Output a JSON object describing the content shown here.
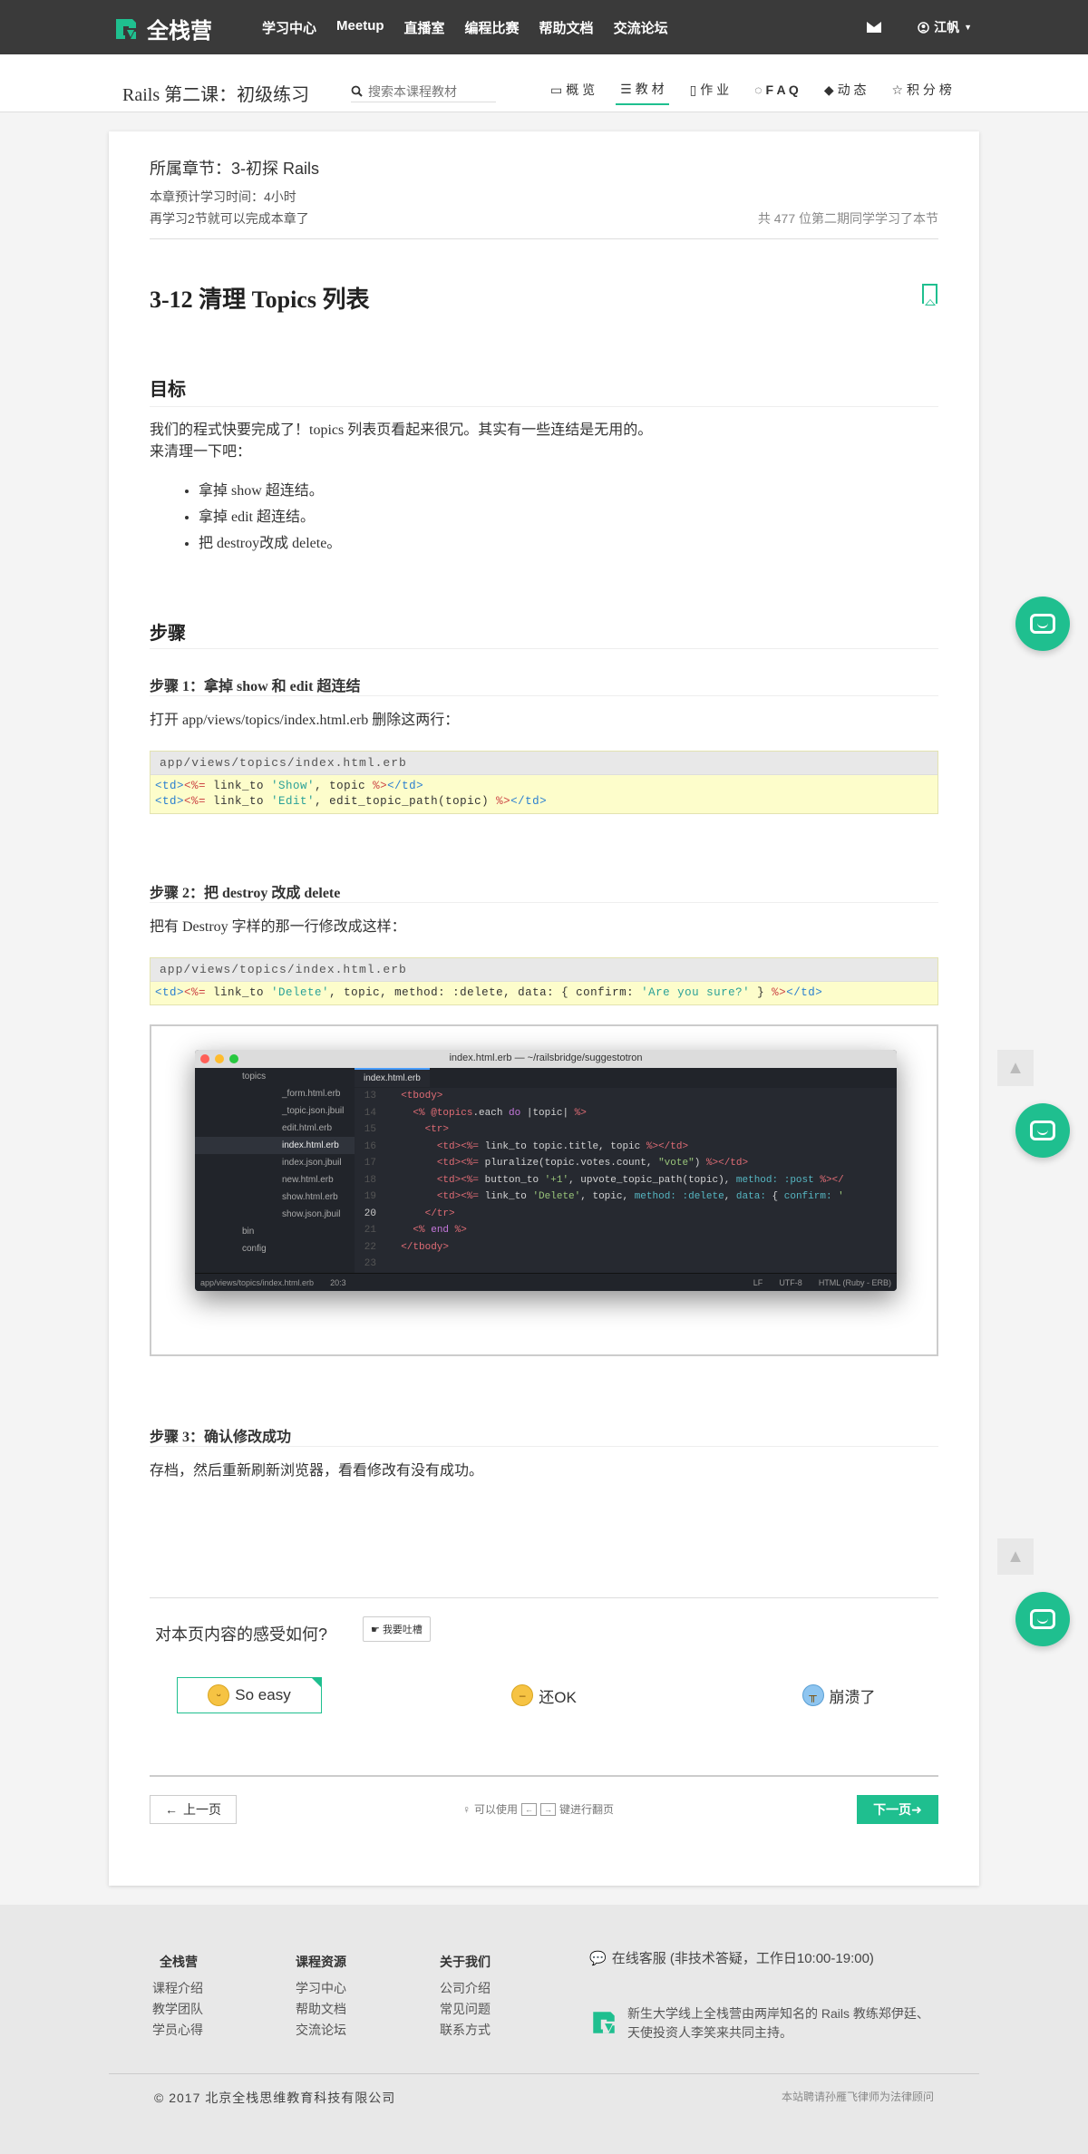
{
  "topnav": {
    "brand": "全栈营",
    "links": [
      "学习中心",
      "Meetup",
      "直播室",
      "编程比赛",
      "帮助文档",
      "交流论坛"
    ],
    "user": "江帆"
  },
  "subnav": {
    "course_title": "Rails 第二课：初级练习",
    "search_placeholder": "搜索本课程教材",
    "tabs": [
      {
        "label": "概 览",
        "icon": "monitor-icon"
      },
      {
        "label": "教 材",
        "icon": "list-icon"
      },
      {
        "label": "作 业",
        "icon": "file-icon"
      },
      {
        "label": "F A Q",
        "icon": "chat-icon"
      },
      {
        "label": "动 态",
        "icon": "tag-icon"
      },
      {
        "label": "积 分 榜",
        "icon": "star-icon"
      }
    ],
    "active_tab": 1
  },
  "card": {
    "chapter": "所属章节：3-初探 Rails",
    "study_time": "本章预计学习时间：4小时",
    "remaining": "再学习2节就可以完成本章了",
    "learners": "共 477 位第二期同学学习了本节",
    "lesson_title": "3-12 清理 Topics 列表",
    "goal_heading": "目标",
    "goal_text_1": "我们的程式快要完成了！topics 列表页看起来很冗。其实有一些连结是无用的。",
    "goal_text_2": "来清理一下吧：",
    "goal_bullets": [
      "拿掉 show 超连结。",
      "拿掉 edit 超连结。",
      "把 destroy改成 delete。"
    ],
    "steps_heading": "步骤",
    "step1_heading": "步骤 1：拿掉 show 和 edit 超连结",
    "step1_text": "打开 app/views/topics/index.html.erb 删除这两行：",
    "code1_file": "app/views/topics/index.html.erb",
    "step2_heading": "步骤 2：把 destroy 改成 delete",
    "step2_text": "把有 Destroy 字样的那一行修改成这样：",
    "code2_file": "app/views/topics/index.html.erb",
    "step3_heading": "步骤 3：确认修改成功",
    "step3_text": "存档，然后重新刷新浏览器，看看修改有没有成功。"
  },
  "editor": {
    "title": "index.html.erb — ~/railsbridge/suggestotron",
    "tab": "index.html.erb",
    "files": [
      "topics",
      "_form.html.erb",
      "_topic.json.jbuil",
      "edit.html.erb",
      "index.html.erb",
      "index.json.jbuil",
      "new.html.erb",
      "show.html.erb",
      "show.json.jbuil",
      "",
      "bin",
      "config"
    ],
    "line_numbers": [
      "13",
      "14",
      "15",
      "16",
      "17",
      "18",
      "19",
      "20",
      "21",
      "22",
      "23"
    ],
    "status_path": "app/views/topics/index.html.erb",
    "status_pos": "20:3",
    "status_lf": "LF",
    "status_enc": "UTF-8",
    "status_grammar": "HTML (Ruby - ERB)"
  },
  "feedback": {
    "question": "对本页内容的感受如何?",
    "complain_button": "我要吐槽",
    "options": [
      "So easy",
      "还OK",
      "崩溃了"
    ]
  },
  "pager": {
    "prev": "上一页",
    "hint_before": "可以使用",
    "hint_after": "键进行翻页",
    "next": "下一页"
  },
  "footer": {
    "col1": {
      "title": "全栈营",
      "items": [
        "课程介绍",
        "教学团队",
        "学员心得"
      ]
    },
    "col2": {
      "title": "课程资源",
      "items": [
        "学习中心",
        "帮助文档",
        "交流论坛"
      ]
    },
    "col3": {
      "title": "关于我们",
      "items": [
        "公司介绍",
        "常见问题",
        "联系方式"
      ]
    },
    "service": "在线客服 (非技术答疑，工作日10:00-19:00)",
    "description": "新生大学线上全栈营由两岸知名的 Rails 教练郑伊廷、天使投资人李笑来共同主持。",
    "copyright": "© 2017 北京全栈思维教育科技有限公司",
    "legal": "本站聘请孙雁飞律师为法律顾问"
  },
  "colors": {
    "accent": "#1fbf8f",
    "nav_bg": "#3a3a3a"
  }
}
